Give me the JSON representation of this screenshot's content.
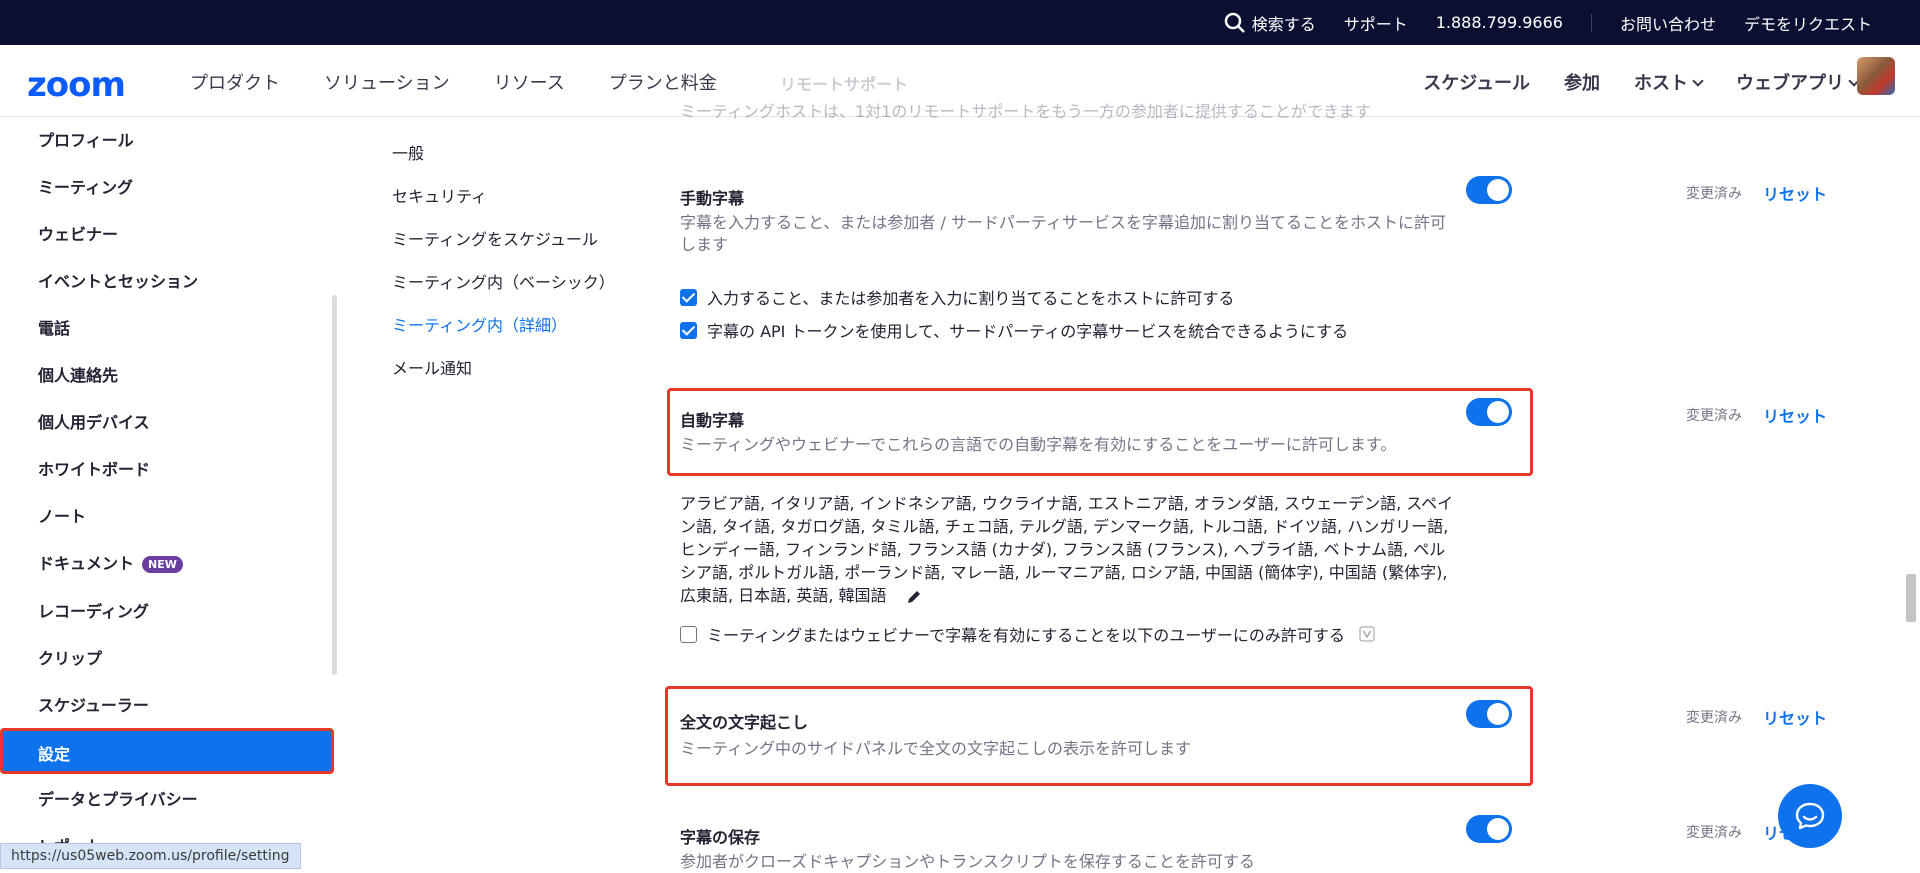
{
  "utilbar": {
    "search": "検索する",
    "support": "サポート",
    "phone": "1.888.799.9666",
    "contact": "お問い合わせ",
    "demo": "デモをリクエスト"
  },
  "nav": {
    "logo": "zoom",
    "links": [
      "プロダクト",
      "ソリューション",
      "リソース",
      "プランと料金"
    ],
    "right": [
      "スケジュール",
      "参加",
      "ホスト",
      "ウェブアプリ"
    ]
  },
  "sidebar": {
    "items": [
      "プロフィール",
      "ミーティング",
      "ウェビナー",
      "イベントとセッション",
      "電話",
      "個人連絡先",
      "個人用デバイス",
      "ホワイトボード",
      "ノート",
      "ドキュメント",
      "レコーディング",
      "クリップ",
      "スケジューラー",
      "設定",
      "データとプライバシー",
      "レポート"
    ],
    "new_badge": "NEW",
    "status_url": "https://us05web.zoom.us/profile/setting"
  },
  "subnav": {
    "items": [
      "一般",
      "セキュリティ",
      "ミーティングをスケジュール",
      "ミーティング内（ベーシック）",
      "ミーティング内（詳細）",
      "メール通知"
    ]
  },
  "content": {
    "faded_title": "リモートサポート",
    "faded_desc": "ミーティングホストは、1対1のリモートサポートをもう一方の参加者に提供することができます",
    "modified": "変更済み",
    "reset": "リセット",
    "manual_captions": {
      "title": "手動字幕",
      "desc": "字幕を入力すること、または参加者 / サードパーティサービスを字幕追加に割り当てることをホストに許可します",
      "opt1": "入力すること、または参加者を入力に割り当てることをホストに許可する",
      "opt2": "字幕の API トークンを使用して、サードパーティの字幕サービスを統合できるようにする"
    },
    "auto_captions": {
      "title": "自動字幕",
      "desc": "ミーティングやウェビナーでこれらの言語での自動字幕を有効にすることをユーザーに許可します。",
      "languages": "アラビア語, イタリア語, インドネシア語, ウクライナ語, エストニア語, オランダ語, スウェーデン語, スペイン語, タイ語, タガログ語, タミル語, チェコ語, テルグ語, デンマーク語, トルコ語, ドイツ語, ハンガリー語, ヒンディー語, フィンランド語, フランス語 (カナダ), フランス語 (フランス), ヘブライ語, ベトナム語, ペルシア語, ポルトガル語, ポーランド語, マレー語, ルーマニア語, ロシア語, 中国語 (簡体字), 中国語 (繁体字), 広東語, 日本語, 英語, 韓国語",
      "opt": "ミーティングまたはウェビナーで字幕を有効にすることを以下のユーザーにのみ許可する"
    },
    "full_transcript": {
      "title": "全文の文字起こし",
      "desc": "ミーティング中のサイドパネルで全文の文字起こしの表示を許可します"
    },
    "save_captions": {
      "title": "字幕の保存",
      "desc": "参加者がクローズドキャプションやトランスクリプトを保存することを許可する"
    }
  }
}
